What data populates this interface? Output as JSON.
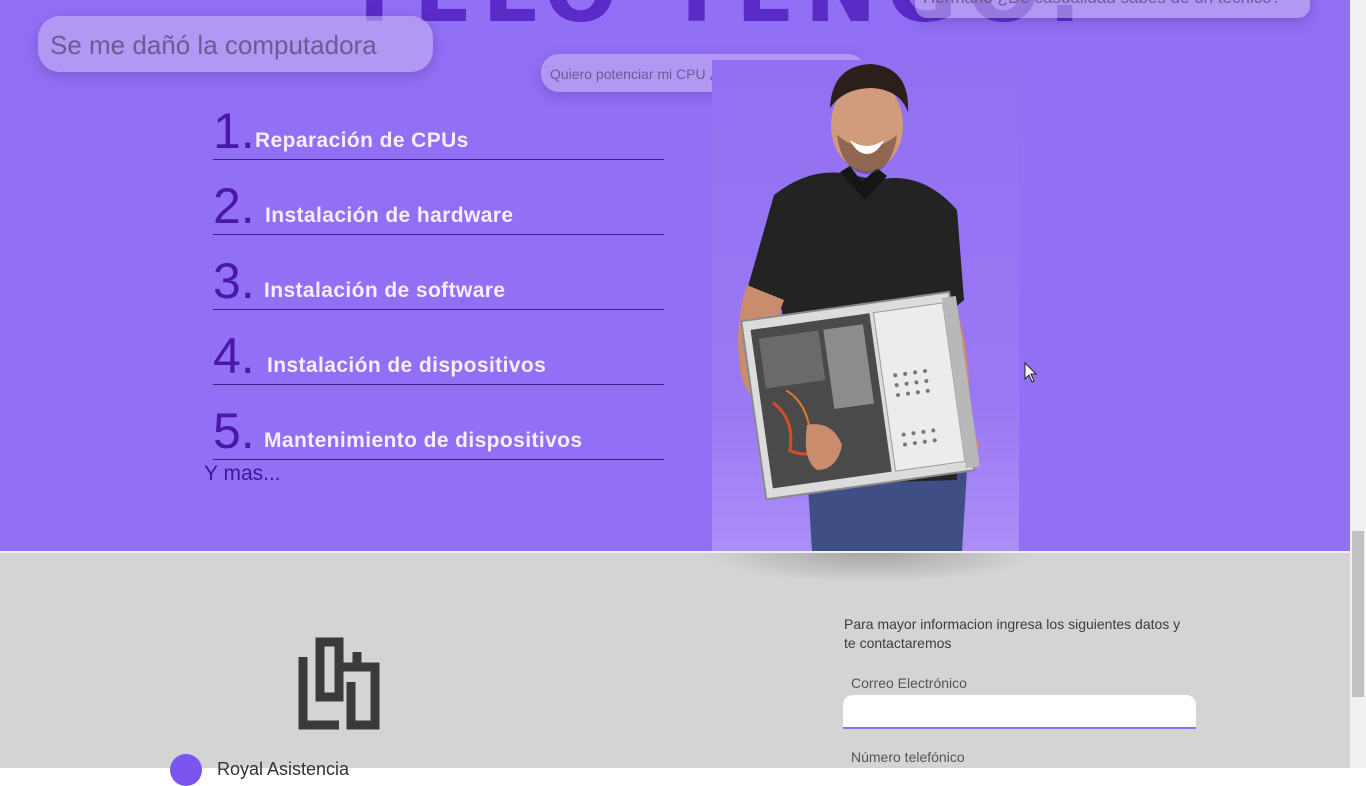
{
  "hero": {
    "title": "TELO TENGO.",
    "bubbles": {
      "top_right": "Hermano ¿De casualidad sabes de un técnico?",
      "left": "Se me dañó la computadora",
      "middle": "Quiero potenciar mi CPU ¿Sabes de alguien?"
    },
    "services": [
      {
        "number": "1.",
        "label": "Reparación de CPUs"
      },
      {
        "number": "2.",
        "label": "Instalación de hardware"
      },
      {
        "number": "3.",
        "label": "Instalación de software"
      },
      {
        "number": "4.",
        "label": "Instalación de dispositivos"
      },
      {
        "number": "5.",
        "label": "Mantenimiento de dispositivos"
      }
    ],
    "more": "Y mas...",
    "photo_description": "technician-holding-open-pc-case"
  },
  "footer": {
    "logo_icon": "brand-logo-icon",
    "contact_icon": "location-icon",
    "contact_text": "Royal Asistencia",
    "form": {
      "intro": "Para mayor informacion ingresa los siguientes datos y te contactaremos",
      "email_label": "Correo Electrónico",
      "email_value": "",
      "phone_label": "Número telefónico"
    }
  },
  "colors": {
    "hero_bg": "#9270f5",
    "number_color": "#4a18a8",
    "footer_bg": "#d4d4d4",
    "accent": "#8d6cf2"
  }
}
